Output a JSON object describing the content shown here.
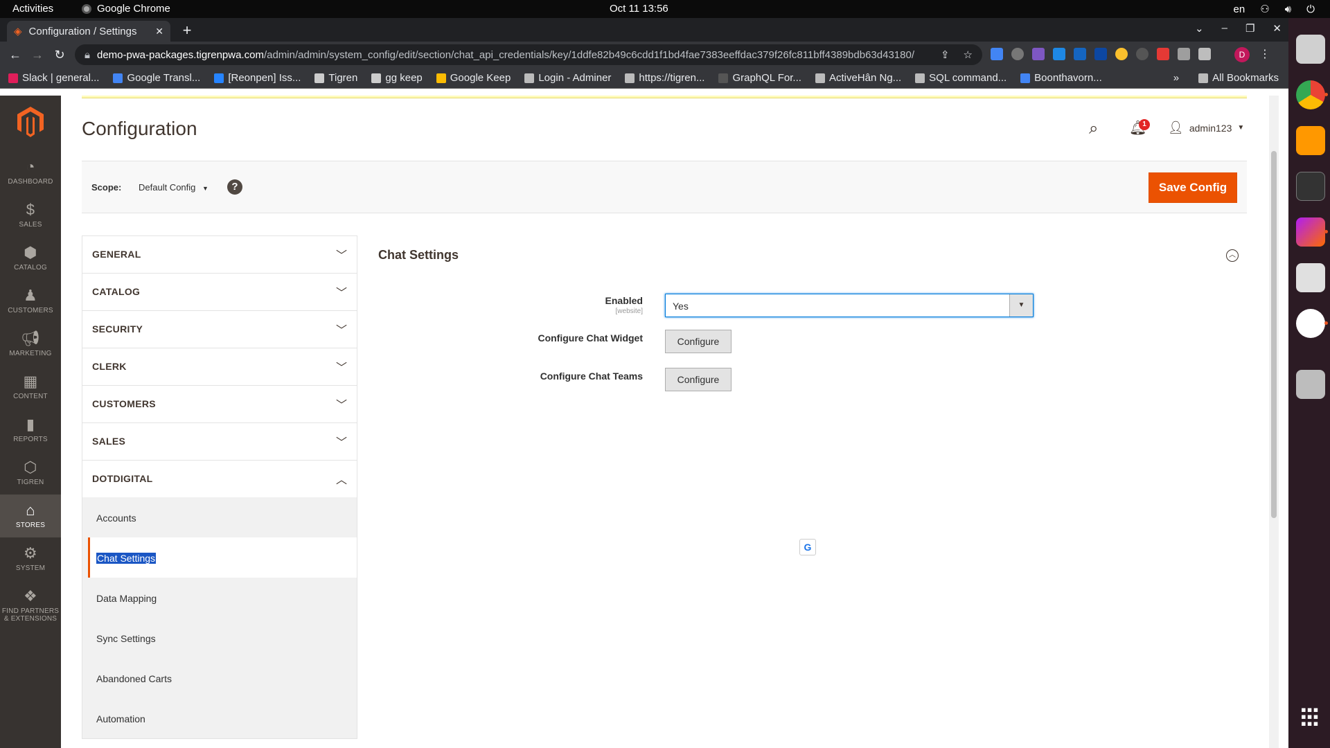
{
  "system": {
    "activities": "Activities",
    "app_name": "Google Chrome",
    "clock": "Oct 11  13:56",
    "lang": "en"
  },
  "browser": {
    "tab_title": "Configuration / Settings",
    "url_host": "demo-pwa-packages.tigrenpwa.com",
    "url_path": "/admin/admin/system_config/edit/section/chat_api_credentials/key/1ddfe82b49c6cdd1f1bd4fae7383eeffdac379f26fc811bff4389bdb63d43180/",
    "profile_initial": "D",
    "bookmarks": [
      {
        "label": "Slack | general...",
        "color": "#e01e5a"
      },
      {
        "label": "Google Transl...",
        "color": "#4285f4"
      },
      {
        "label": "[Reonpen] Iss...",
        "color": "#2684ff"
      },
      {
        "label": "Tigren",
        "color": "#cccccc"
      },
      {
        "label": "gg keep",
        "color": "#cccccc"
      },
      {
        "label": "Google Keep",
        "color": "#fbbc04"
      },
      {
        "label": "Login - Adminer",
        "color": "#bbbbbb"
      },
      {
        "label": "https://tigren...",
        "color": "#bbbbbb"
      },
      {
        "label": "GraphQL For...",
        "color": "#555555"
      },
      {
        "label": "ActiveHân Ng...",
        "color": "#bbbbbb"
      },
      {
        "label": "SQL command...",
        "color": "#bbbbbb"
      },
      {
        "label": "Boonthavorn...",
        "color": "#4285f4"
      }
    ],
    "bookmarks_overflow": "»",
    "all_bookmarks": "All Bookmarks"
  },
  "adminnav": {
    "items": [
      {
        "label": "DASHBOARD",
        "icon": "dashboard-icon"
      },
      {
        "label": "SALES",
        "icon": "dollar-icon"
      },
      {
        "label": "CATALOG",
        "icon": "cube-icon"
      },
      {
        "label": "CUSTOMERS",
        "icon": "person-icon"
      },
      {
        "label": "MARKETING",
        "icon": "megaphone-icon"
      },
      {
        "label": "CONTENT",
        "icon": "layout-icon"
      },
      {
        "label": "REPORTS",
        "icon": "bar-chart-icon"
      },
      {
        "label": "TIGREN",
        "icon": "hexagon-icon"
      },
      {
        "label": "STORES",
        "icon": "store-icon"
      },
      {
        "label": "SYSTEM",
        "icon": "gear-icon"
      },
      {
        "label": "FIND PARTNERS",
        "label2": "& EXTENSIONS",
        "icon": "boxes-icon"
      }
    ]
  },
  "header": {
    "title": "Configuration",
    "notifications_count": "1",
    "username": "admin123"
  },
  "scope": {
    "label": "Scope:",
    "value": "Default Config",
    "help": "?",
    "save_label": "Save Config"
  },
  "sections": [
    {
      "label": "GENERAL"
    },
    {
      "label": "CATALOG"
    },
    {
      "label": "SECURITY"
    },
    {
      "label": "CLERK"
    },
    {
      "label": "CUSTOMERS"
    },
    {
      "label": "SALES"
    },
    {
      "label": "DOTDIGITAL"
    }
  ],
  "dotdigital_items": [
    {
      "label": "Accounts"
    },
    {
      "label": "Chat Settings"
    },
    {
      "label": "Data Mapping"
    },
    {
      "label": "Sync Settings"
    },
    {
      "label": "Abandoned Carts"
    },
    {
      "label": "Automation"
    }
  ],
  "panel": {
    "title": "Chat Settings",
    "enabled_label": "Enabled",
    "enabled_scope": "[website]",
    "enabled_value": "Yes",
    "widget_label": "Configure Chat Widget",
    "widget_button": "Configure",
    "teams_label": "Configure Chat Teams",
    "teams_button": "Configure"
  },
  "colors": {
    "accent": "#eb5202",
    "nav_bg": "#373330",
    "selection": "#1a56c4"
  }
}
